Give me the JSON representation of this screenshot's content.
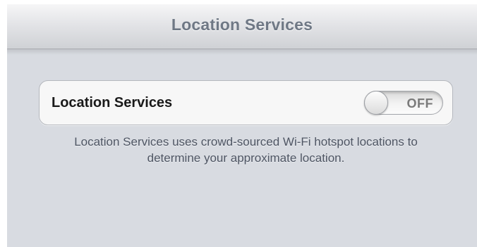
{
  "navbar": {
    "title": "Location Services"
  },
  "settings": {
    "location_services": {
      "label": "Location Services",
      "toggle_state": "OFF",
      "enabled": false
    },
    "footer_note": "Location Services uses crowd-sourced Wi-Fi hotspot locations to determine your approximate location."
  }
}
